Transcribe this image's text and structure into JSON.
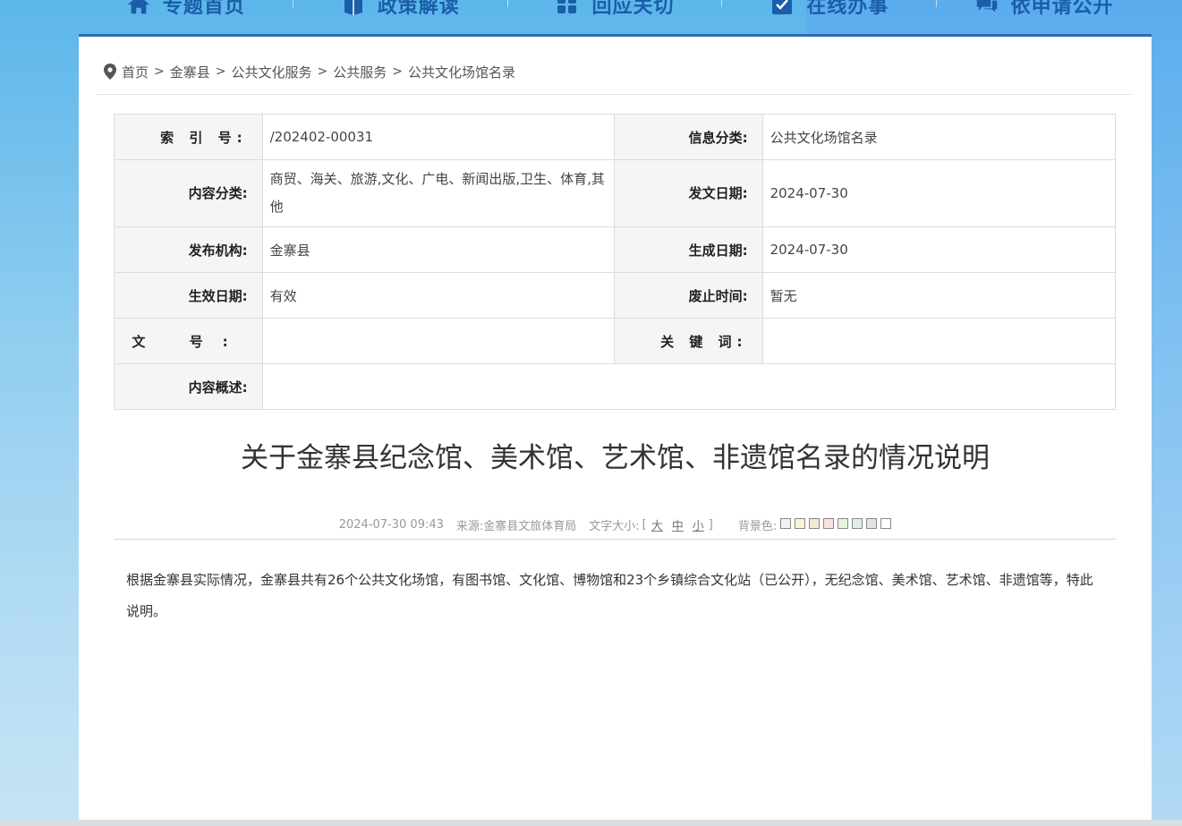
{
  "nav": [
    {
      "icon": "home-icon",
      "label": "专题首页"
    },
    {
      "icon": "book-icon",
      "label": "政策解读"
    },
    {
      "icon": "grid-icon",
      "label": "回应关切"
    },
    {
      "icon": "checkbox-icon",
      "label": "在线办事"
    },
    {
      "icon": "chat-icon",
      "label": "依申请公开"
    }
  ],
  "breadcrumb": [
    "首页",
    "金寨县",
    "公共文化服务",
    "公共服务",
    "公共文化场馆名录"
  ],
  "breadcrumb_sep": ">",
  "meta": {
    "index_label": "索 引 号:",
    "index_value": "/202402-00031",
    "info_category_label": "信息分类:",
    "info_category_value": "公共文化场馆名录",
    "content_category_label": "内容分类:",
    "content_category_value": "商贸、海关、旅游,文化、广电、新闻出版,卫生、体育,其他",
    "issue_date_label": "发文日期:",
    "issue_date_value": "2024-07-30",
    "publisher_label": "发布机构:",
    "publisher_value": "金寨县",
    "created_date_label": "生成日期:",
    "created_date_value": "2024-07-30",
    "effective_date_label": "生效日期:",
    "effective_date_value": "有效",
    "expiry_label": "废止时间:",
    "expiry_value": "暂无",
    "doc_no_label": "文  号:",
    "doc_no_value": "",
    "keywords_label": "关 键 词:",
    "keywords_value": "",
    "summary_label": "内容概述:",
    "summary_value": ""
  },
  "article": {
    "title": "关于金寨县纪念馆、美术馆、艺术馆、非遗馆名录的情况说明",
    "datetime": "2024-07-30 09:43",
    "source": "来源:金寨县文旅体育局",
    "font_size_label": "文字大小:",
    "font_sizes": [
      "大",
      "中",
      "小"
    ],
    "bracket_open": "[",
    "bracket_close": "]",
    "bg_color_label": "背景色:",
    "bg_colors": [
      "#f2f2f2",
      "#faf4dc",
      "#f8e6d4",
      "#fbe2e2",
      "#e6f4dc",
      "#dcf1ee",
      "#e4e4e4",
      "#ffffff"
    ],
    "body": "根据金寨县实际情况，金寨县共有26个公共文化场馆，有图书馆、文化馆、博物馆和23个乡镇综合文化站（已公开），无纪念馆、美术馆、艺术馆、非遗馆等，特此说明。"
  }
}
